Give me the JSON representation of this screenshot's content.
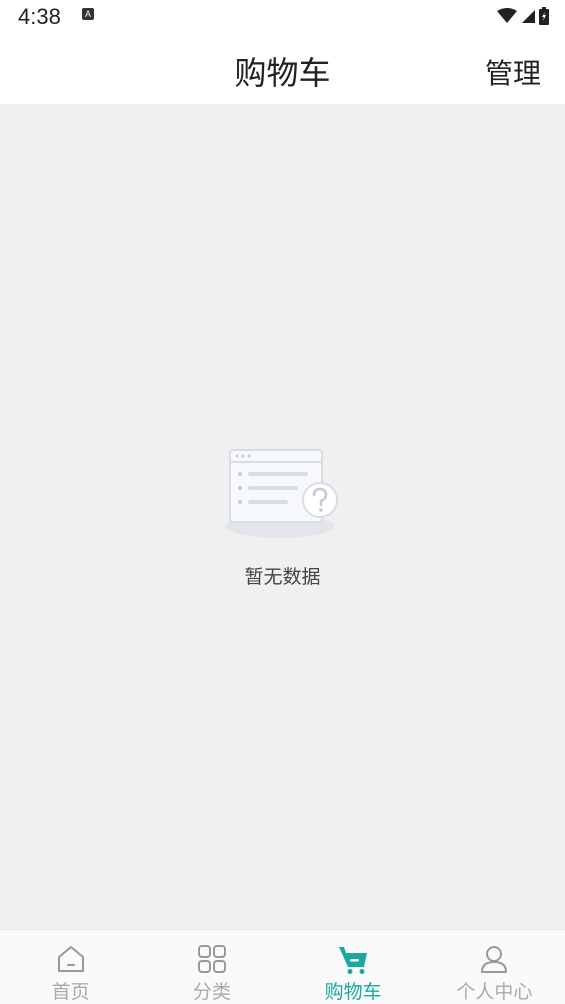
{
  "status_bar": {
    "time": "4:38",
    "notification_badge": "A"
  },
  "header": {
    "title": "购物车",
    "manage_label": "管理"
  },
  "empty_state": {
    "text": "暂无数据",
    "icon": "empty-data-icon"
  },
  "tab_bar": {
    "tabs": [
      {
        "label": "首页",
        "icon": "home-icon",
        "active": false
      },
      {
        "label": "分类",
        "icon": "grid-icon",
        "active": false
      },
      {
        "label": "购物车",
        "icon": "cart-icon",
        "active": true
      },
      {
        "label": "个人中心",
        "icon": "user-icon",
        "active": false
      }
    ]
  },
  "colors": {
    "accent": "#1aa8a0",
    "inactive": "#aaaaaa",
    "background": "#f0f0f0"
  }
}
